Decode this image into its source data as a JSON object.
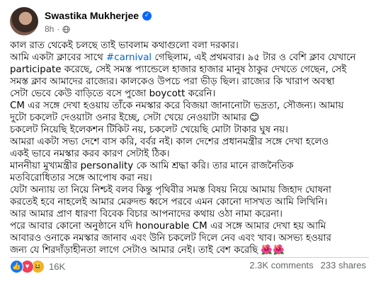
{
  "post": {
    "author_name": "Swastika Mukherjee",
    "time": "8h",
    "lines": [
      {
        "text": "কাল রাত থেকেই চলছে তাই ভাবলাম কথাগুলো বলা দরকার।"
      },
      {
        "before": "আমি একটা ক্লাবের সাথে ",
        "hashtag": "#carnival",
        "after": " গেছিলাম, এই প্রথমবার। ৯৫ টার ও বেশি ক্লাব যেখানে"
      },
      {
        "text": "participate করেছে, সেই সমস্ত প্যান্ডেলে হাজার হাজার মানুষ ঠাকুর দেখতে গেছেন, সেই"
      },
      {
        "text": "সমস্ত ক্লাব আমাদের রাজ্যের। কালকেও উপচে পরা ভীড় ছিল। রাজ্যের কি খারাপ অবস্থা"
      },
      {
        "text": "সেটা ভেবে কেউ বাড়িতে বসে পুজো boycott করেনি।"
      },
      {
        "text": "CM এর সঙ্গে দেখা হওয়ায় তাঁকে নমস্কার করে বিজয়া জানানোটা ভদ্রতা, সৌজন্য। আমায়"
      },
      {
        "text": "দুটো চকলেট দেওয়াটা ওনার ইচ্ছে, সেটা খেয়ে নেওয়াটা আমার 😊"
      },
      {
        "text": "চকলেট নিয়েছি ইলেকশন টিকিট নয়, চকলেট খেয়েছি মোটা টাকার ঘুষ নয়।"
      },
      {
        "text": "আমরা একটা সভ্য দেশে বাস করি, বর্বর নই। কাল দেশের প্রধানমন্ত্রীর সঙ্গে দেখা হলেও"
      },
      {
        "text": "একই ভাবে নমস্কার করব কারণ সেটাই ঠিক।"
      },
      {
        "text": "মাননীয়া মুখ্যমন্ত্রীর personality কে আমি শ্রদ্ধা করি। তার মানে রাজনৈতিক"
      },
      {
        "text": "মতবিরোধিতার সঙ্গে আপোষ করা নয়।"
      },
      {
        "text": "যেটা অন্যায় তা নিয়ে নিশ্চই বলব কিন্তু পৃথিবীর সমস্ত বিষয় নিয়ে আমায় জিহাদ ঘোষনা"
      },
      {
        "text": "করতেই হবে নাহলেই আমার মেরুদন্ড ধ্বসে পরবে এমন কোনো দাসখত আমি লিখিনি।"
      },
      {
        "text": "আর আমার প্রাণ ধারণা বিবেক বিচার আপনাদের কথায় ওঠা নামা করেনা।"
      },
      {
        "text": "পরে আবার কোনো অনুষ্ঠানে যদি honourable CM এর সঙ্গে আমার দেখা হয় আমি"
      },
      {
        "text": "আবারও ওনাকে নমস্কার জানাব এবং উনি চকলেট দিলে নেব এবং খাব। অসভ্য হওয়ার"
      },
      {
        "text": "জন্য যে শিরদাঁড়াহীনতা লাগে সেটাও আমার নেই। তাই বেশ করেছি 🌺🌺"
      }
    ]
  },
  "footer": {
    "reaction_count": "16K",
    "comments": "2.3K comments",
    "shares": "233 shares",
    "reactions": [
      "like-reaction",
      "love-reaction",
      "haha-reaction"
    ]
  },
  "colors": {
    "link": "#0064d1",
    "verified": "#0866ff",
    "secondary_text": "#65676b"
  }
}
